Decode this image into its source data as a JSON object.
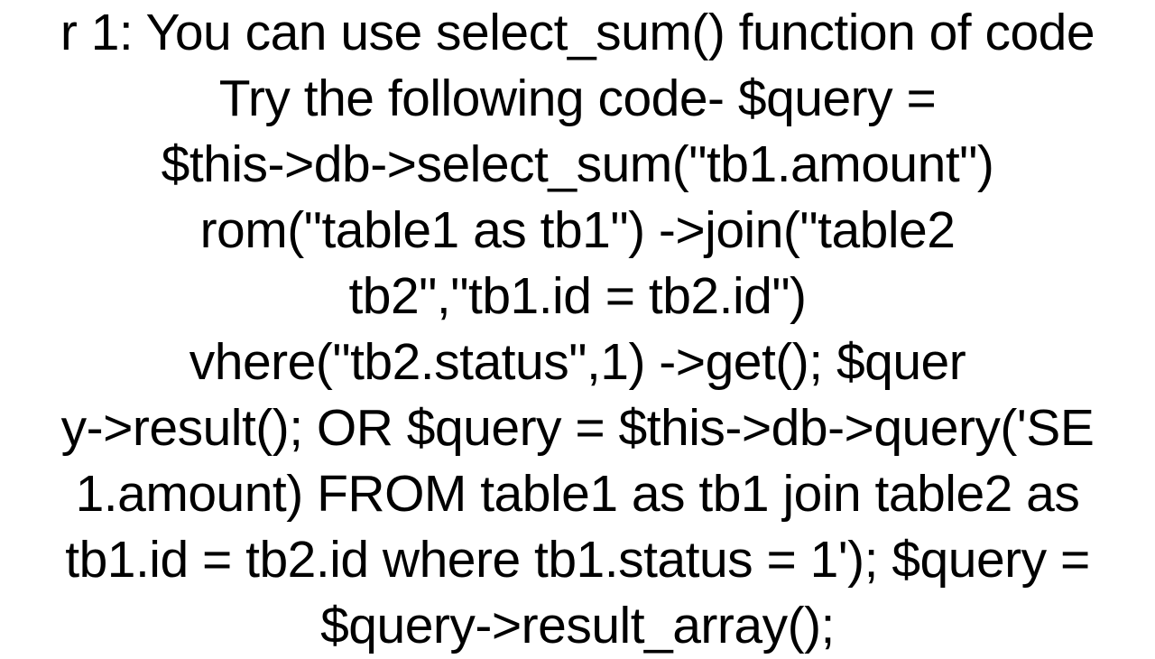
{
  "content": {
    "lines": [
      "r 1: You can use select_sum() function of code",
      "Try the following code- $query =",
      "$this->db->select_sum(\"tb1.amount\")",
      "rom(\"table1 as tb1\")                    ->join(\"table2",
      "tb2\",\"tb1.id = tb2.id\")",
      "vhere(\"tb2.status\",1)                       ->get(); $quer",
      "y->result();  OR $query = $this->db->query('SE",
      "1.amount) FROM table1 as tb1 join table2 as",
      "tb1.id = tb2.id where tb1.status = 1'); $query =",
      "$query->result_array();"
    ]
  }
}
